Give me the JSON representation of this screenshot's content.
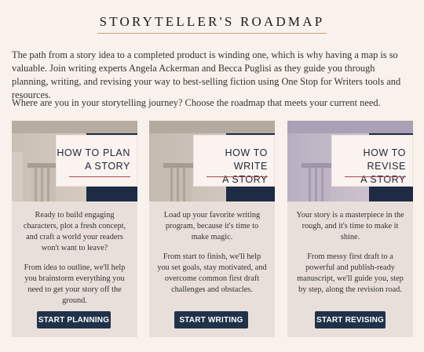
{
  "header": {
    "title": "STORYTELLER'S ROADMAP"
  },
  "intro": "The path from a story idea to a completed product is winding one, which is why having a map is so valuable. Join writing experts Angela Ackerman and Becca Puglisi as they guide you through planning, writing, and revising your way to best-selling fiction using One Stop for Writers tools and resources.",
  "question": "Where are you in your storytelling journey? Choose the roadmap that meets your current need.",
  "cards": [
    {
      "title": "HOW TO PLAN\nA STORY",
      "p1": "Ready to build engaging characters, plot a fresh concept, and craft a world your readers won't want to leave?",
      "p2": "From idea to outline, we'll help you brainstorm everything you need to get your story off the ground.",
      "button": "START PLANNING"
    },
    {
      "title": "HOW TO WRITE\nA STORY",
      "p1": "Load up your favorite writing program, because it's time to make magic.",
      "p2": "From start to finish, we'll help you set goals, stay motivated, and overcome common first draft challenges and obstacles.",
      "button": "START WRITING"
    },
    {
      "title": "HOW TO REVISE\nA STORY",
      "p1": "Your story is a masterpiece in the rough, and it's time to make it shine.",
      "p2": "From messy first draft to a powerful and publish-ready manuscript, we'll guide you, step by step, along the revision road.",
      "button": "START REVISING"
    }
  ],
  "colors": {
    "background": "#f8f1ec",
    "card": "#e8dfda",
    "button": "#1f3249",
    "navy_block": "#1e2b45",
    "accent_line": "#a54a4a"
  }
}
